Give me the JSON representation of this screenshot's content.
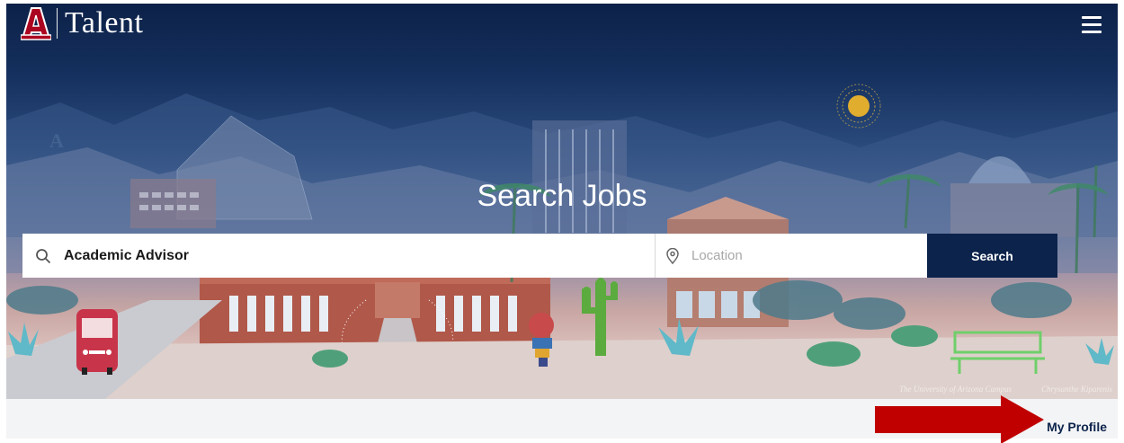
{
  "header": {
    "brand_name": "Talent",
    "logo_icon": "university-a-logo",
    "menu_icon": "hamburger-menu-icon"
  },
  "hero": {
    "title": "Search Jobs",
    "credit_campus": "The University of Arizona Campus",
    "credit_artist": "Chrysanthe Kiparenis"
  },
  "search": {
    "keyword_value": "Academic Advisor",
    "location_placeholder": "Location",
    "button_label": "Search"
  },
  "footer": {
    "profile_link": "My Profile"
  },
  "colors": {
    "navy": "#0c234b",
    "red_arrow": "#c00000",
    "strip_bg": "#f3f4f6"
  }
}
